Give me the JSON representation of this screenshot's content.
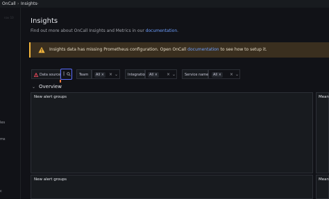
{
  "breadcrumbs": [
    "OnCall",
    "Insights"
  ],
  "sidebar": {
    "faint_text": "nav 10",
    "items": [
      "les",
      "ms",
      "c"
    ]
  },
  "page": {
    "title": "Insights",
    "description_prefix": "Find out more about OnCall Insights and Metrics in our ",
    "description_link": "documentation",
    "description_suffix": "."
  },
  "warning": {
    "text_prefix": "Insights data has missing Prometheus configuration. Open OnCall ",
    "link": "documentation",
    "text_suffix": " to see how to setup it.",
    "color": "#f5b73d"
  },
  "filters": {
    "data_source": {
      "label": "Data source",
      "placeholder": "|"
    },
    "team": {
      "label": "Team",
      "value": "All"
    },
    "integration": {
      "label": "Integration",
      "value": "All"
    },
    "service_name": {
      "label": "Service name",
      "value": "All"
    }
  },
  "section": {
    "title": "Overview"
  },
  "panels": [
    {
      "title": "New alert groups"
    },
    {
      "title": "Mean"
    },
    {
      "title": "New alert groups"
    },
    {
      "title": "Mean"
    }
  ]
}
